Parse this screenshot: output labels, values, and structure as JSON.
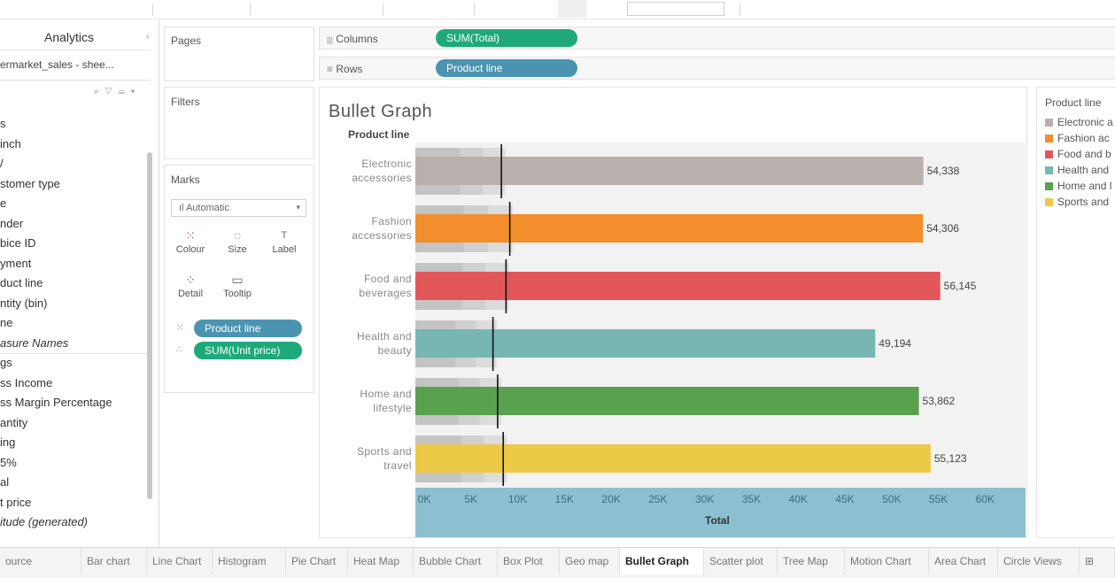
{
  "data_pane": {
    "tab_label": "Analytics",
    "collapse_glyph": "‹",
    "data_source": "ermarket_sales - shee...",
    "tool_glyphs": "⌕ ▽ ☰ ▾",
    "fields": [
      {
        "text": "s"
      },
      {
        "text": "inch"
      },
      {
        "text": "/"
      },
      {
        "text": "stomer type"
      },
      {
        "text": "e"
      },
      {
        "text": "nder"
      },
      {
        "text": "bice ID"
      },
      {
        "text": "yment"
      },
      {
        "text": "duct line"
      },
      {
        "text": "ntity (bin)"
      },
      {
        "text": "ne"
      },
      {
        "text": "asure Names",
        "italic": true
      },
      {
        "text": "gs"
      },
      {
        "text": "ss Income"
      },
      {
        "text": "ss Margin Percentage"
      },
      {
        "text": "antity"
      },
      {
        "text": "ing"
      },
      {
        "text": "5%"
      },
      {
        "text": "al"
      },
      {
        "text": "t price"
      },
      {
        "text": "itude (generated)",
        "italic": true
      }
    ]
  },
  "shelves": {
    "pages_label": "Pages",
    "filters_label": "Filters",
    "columns_label": "Columns",
    "columns_icon": "|||",
    "columns_pill": "SUM(Total)",
    "rows_label": "Rows",
    "rows_icon": "≡",
    "rows_pill": "Product line"
  },
  "marks": {
    "title": "Marks",
    "type_label": "Automatic",
    "type_icon": "ıl",
    "buttons": [
      {
        "label": "Colour",
        "icon": "⁙"
      },
      {
        "label": "Size",
        "icon": "◌"
      },
      {
        "label": "Label",
        "icon": "T"
      },
      {
        "label": "Detail",
        "icon": "⁘"
      },
      {
        "label": "Tooltip",
        "icon": "▭"
      }
    ],
    "pills": [
      {
        "label": "Product line",
        "icon": "⁙"
      },
      {
        "label": "SUM(Unit price)",
        "icon": "∴"
      }
    ]
  },
  "view": {
    "title": "Bullet Graph",
    "row_header": "Product line"
  },
  "legend": {
    "title": "Product line",
    "items": [
      {
        "label": "Electronic a",
        "color": "#b8b0ac"
      },
      {
        "label": "Fashion ac",
        "color": "#f28e2b"
      },
      {
        "label": "Food and b",
        "color": "#e15759"
      },
      {
        "label": "Health and",
        "color": "#76b7b2"
      },
      {
        "label": "Home and l",
        "color": "#59a14f"
      },
      {
        "label": "Sports and",
        "color": "#edc948"
      }
    ]
  },
  "chart_data": {
    "type": "bar",
    "title": "Bullet Graph",
    "xlabel": "Total",
    "ylabel": "Product line",
    "xlim": [
      0,
      63000
    ],
    "x_ticks": [
      "0K",
      "5K",
      "10K",
      "15K",
      "20K",
      "25K",
      "30K",
      "35K",
      "40K",
      "45K",
      "50K",
      "55K",
      "60K"
    ],
    "x_tick_values": [
      0,
      5000,
      10000,
      15000,
      20000,
      25000,
      30000,
      35000,
      40000,
      45000,
      50000,
      55000,
      60000
    ],
    "categories": [
      {
        "line1": "Electronic",
        "line2": "accessories"
      },
      {
        "line1": "Fashion",
        "line2": "accessories"
      },
      {
        "line1": "Food and",
        "line2": "beverages"
      },
      {
        "line1": "Health and",
        "line2": "beauty"
      },
      {
        "line1": "Home and",
        "line2": "lifestyle"
      },
      {
        "line1": "Sports and",
        "line2": "travel"
      }
    ],
    "values": [
      54338,
      54306,
      56145,
      49194,
      53862,
      55123
    ],
    "value_labels": [
      "54,338",
      "54,306",
      "56,145",
      "49,194",
      "53,862",
      "55,123"
    ],
    "colors": [
      "#b8b0ac",
      "#f28e2b",
      "#e15759",
      "#76b7b2",
      "#59a14f",
      "#edc948"
    ],
    "reference_lines": [
      9200,
      10100,
      9700,
      8300,
      8800,
      9400
    ],
    "bands_outer": [
      9600,
      10400,
      10000,
      8700,
      9200,
      9800
    ],
    "bands_mid": [
      7200,
      7800,
      7500,
      6500,
      6900,
      7300
    ],
    "bands_inner": [
      4800,
      5200,
      5000,
      4300,
      4600,
      4900
    ],
    "grid": false
  },
  "sheet_tabs": [
    {
      "label": "ource"
    },
    {
      "label": "Bar chart"
    },
    {
      "label": "Line Chart"
    },
    {
      "label": "Histogram"
    },
    {
      "label": "Pie Chart"
    },
    {
      "label": "Heat Map"
    },
    {
      "label": "Bubble Chart"
    },
    {
      "label": "Box Plot"
    },
    {
      "label": "Geo map"
    },
    {
      "label": "Bullet Graph",
      "active": true
    },
    {
      "label": "Scatter plot"
    },
    {
      "label": "Tree Map"
    },
    {
      "label": "Motion Chart"
    },
    {
      "label": "Area Chart"
    },
    {
      "label": "Circle Views"
    },
    {
      "label": "⊞"
    }
  ]
}
